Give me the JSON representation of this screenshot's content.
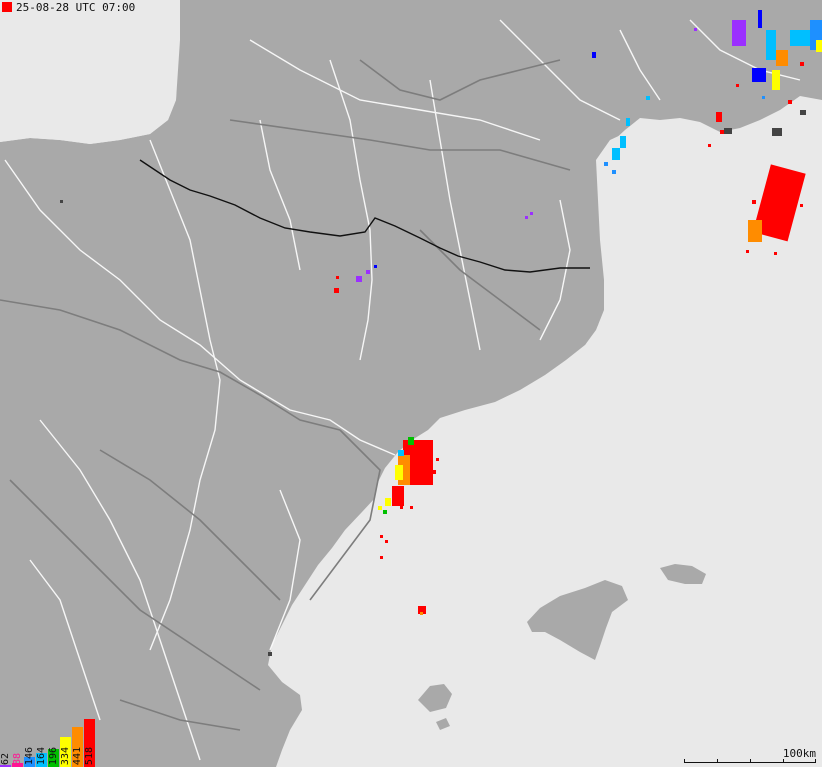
{
  "header": {
    "timestamp": "25-08-28 UTC 07:00",
    "marker_color": "#ff0000"
  },
  "scale": {
    "label": "100km"
  },
  "legend": {
    "items": [
      {
        "label": "62",
        "color": "#9b30ff"
      },
      {
        "label": "88",
        "color": "#ff1493"
      },
      {
        "label": "146",
        "color": "#1e90ff"
      },
      {
        "label": "164",
        "color": "#00bfff"
      },
      {
        "label": "196",
        "color": "#00c000"
      },
      {
        "label": "334",
        "color": "#ffff00"
      },
      {
        "label": "441",
        "color": "#ff8c00"
      },
      {
        "label": "518",
        "color": "#ff0000"
      }
    ]
  },
  "map": {
    "land_color": "#a9a9a9",
    "sea_color": "#e9e9e9",
    "road_color": "#ffffff",
    "border_color": "#000000",
    "features": [
      "land-mass",
      "sea",
      "mallorca-island",
      "ibiza-island",
      "menorca-island",
      "road-network",
      "national-border"
    ]
  }
}
